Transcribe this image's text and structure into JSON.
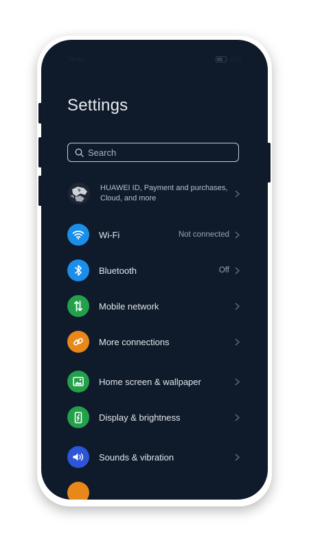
{
  "status_bar": {
    "left_text": "Nvan",
    "right_text": "4:53"
  },
  "page": {
    "title": "Settings"
  },
  "search": {
    "placeholder": "Search"
  },
  "account": {
    "label": "HUAWEI ID, Payment and purchases, Cloud, and more"
  },
  "items": [
    {
      "id": "wifi",
      "label": "Wi-Fi",
      "value": "Not connected",
      "icon": "wifi-icon",
      "color": "#1a8ee8"
    },
    {
      "id": "bluetooth",
      "label": "Bluetooth",
      "value": "Off",
      "icon": "bluetooth-icon",
      "color": "#1a8ee8"
    },
    {
      "id": "mobile-network",
      "label": "Mobile network",
      "value": "",
      "icon": "mobile-data-icon",
      "color": "#22a04a"
    },
    {
      "id": "more-connections",
      "label": "More connections",
      "value": "",
      "icon": "link-icon",
      "color": "#e8871a"
    },
    {
      "id": "home-screen",
      "label": "Home screen & wallpaper",
      "value": "",
      "icon": "image-icon",
      "color": "#22a04a"
    },
    {
      "id": "display",
      "label": "Display & brightness",
      "value": "",
      "icon": "phone-display-icon",
      "color": "#22a04a"
    },
    {
      "id": "sounds",
      "label": "Sounds & vibration",
      "value": "",
      "icon": "speaker-icon",
      "color": "#2c55d8"
    }
  ],
  "colors": {
    "background": "#0f1a2b",
    "text_primary": "#e3e7ec",
    "text_secondary": "#9aa3af",
    "wifi_icon_bg": "#1a8ee8",
    "bluetooth_icon_bg": "#1a8ee8",
    "mobile_network_icon_bg": "#22a04a",
    "more_connections_icon_bg": "#e8871a",
    "home_screen_icon_bg": "#22a04a",
    "display_icon_bg": "#22a04a",
    "sounds_icon_bg": "#2c55d8"
  }
}
